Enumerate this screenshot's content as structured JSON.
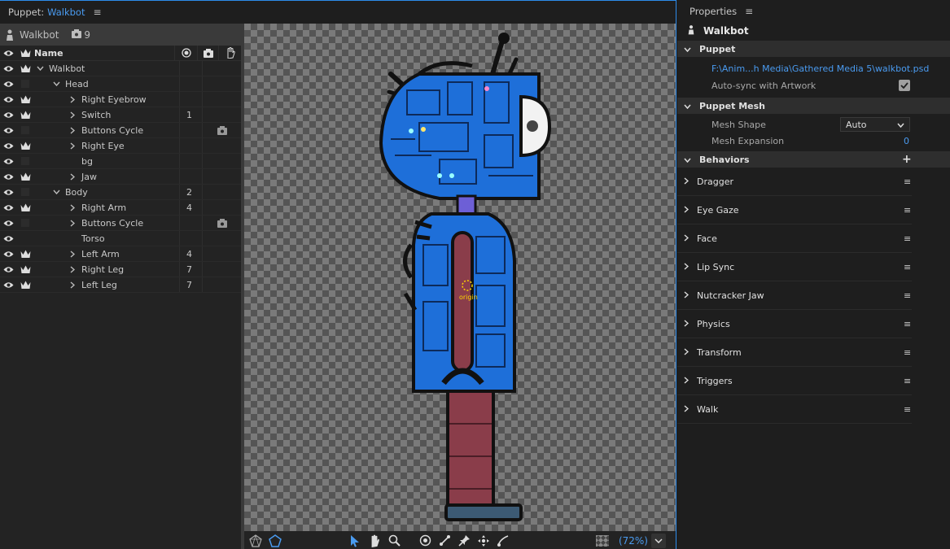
{
  "puppet_panel": {
    "title_prefix": "Puppet: ",
    "title_name": "Walkbot",
    "menu_icon": "hamburger-icon",
    "puppet_name": "Walkbot",
    "camera_count": "9",
    "columns": {
      "name": "Name"
    },
    "layers": [
      {
        "name": "Walkbot",
        "indent": 0,
        "expanded": true,
        "eye": true,
        "crown": true,
        "num": "",
        "cam": false
      },
      {
        "name": "Head",
        "indent": 1,
        "expanded": true,
        "eye": true,
        "crown": false,
        "num": "",
        "cam": false
      },
      {
        "name": "Right Eyebrow",
        "indent": 2,
        "expanded": false,
        "eye": true,
        "crown": true,
        "num": "",
        "cam": false
      },
      {
        "name": "Switch",
        "indent": 2,
        "expanded": false,
        "eye": true,
        "crown": true,
        "num": "1",
        "cam": false
      },
      {
        "name": "Buttons Cycle",
        "indent": 2,
        "expanded": false,
        "eye": true,
        "crown": false,
        "num": "",
        "cam": true
      },
      {
        "name": "Right Eye",
        "indent": 2,
        "expanded": false,
        "eye": true,
        "crown": true,
        "num": "",
        "cam": false
      },
      {
        "name": "bg",
        "indent": 2,
        "leaf": true,
        "eye": true,
        "crown": false,
        "num": "",
        "cam": false
      },
      {
        "name": "Jaw",
        "indent": 2,
        "expanded": false,
        "eye": true,
        "crown": true,
        "num": "",
        "cam": false
      },
      {
        "name": "Body",
        "indent": 1,
        "expanded": true,
        "eye": true,
        "crown": false,
        "num": "2",
        "cam": false
      },
      {
        "name": "Right Arm",
        "indent": 2,
        "expanded": false,
        "eye": true,
        "crown": true,
        "num": "4",
        "cam": false
      },
      {
        "name": "Buttons Cycle",
        "indent": 2,
        "expanded": false,
        "eye": true,
        "crown": false,
        "num": "",
        "cam": true
      },
      {
        "name": "Torso",
        "indent": 2,
        "leaf": true,
        "eye": true,
        "crown": null,
        "num": "",
        "cam": false
      },
      {
        "name": "Left Arm",
        "indent": 2,
        "expanded": false,
        "eye": true,
        "crown": true,
        "num": "4",
        "cam": false
      },
      {
        "name": "Right Leg",
        "indent": 2,
        "expanded": false,
        "eye": true,
        "crown": true,
        "num": "7",
        "cam": false
      },
      {
        "name": "Left Leg",
        "indent": 2,
        "expanded": false,
        "eye": true,
        "crown": true,
        "num": "7",
        "cam": false
      }
    ],
    "canvas": {
      "origin_label": "origin"
    },
    "zoom": "(72%)"
  },
  "properties": {
    "header": "Properties",
    "title": "Walkbot",
    "puppet_section": "Puppet",
    "file_path": "F:\\Anim...h Media\\Gathered Media 5\\walkbot.psd",
    "autosync_label": "Auto-sync with Artwork",
    "autosync_checked": true,
    "mesh_section": "Puppet Mesh",
    "mesh_shape_label": "Mesh Shape",
    "mesh_shape_value": "Auto",
    "mesh_expansion_label": "Mesh Expansion",
    "mesh_expansion_value": "0",
    "behaviors_section": "Behaviors",
    "behaviors": [
      "Dragger",
      "Eye Gaze",
      "Face",
      "Lip Sync",
      "Nutcracker Jaw",
      "Physics",
      "Transform",
      "Triggers",
      "Walk"
    ]
  },
  "colors": {
    "accent": "#4a9bf0",
    "robot_blue": "#1e6fd9",
    "robot_red": "#8a3d4a"
  }
}
